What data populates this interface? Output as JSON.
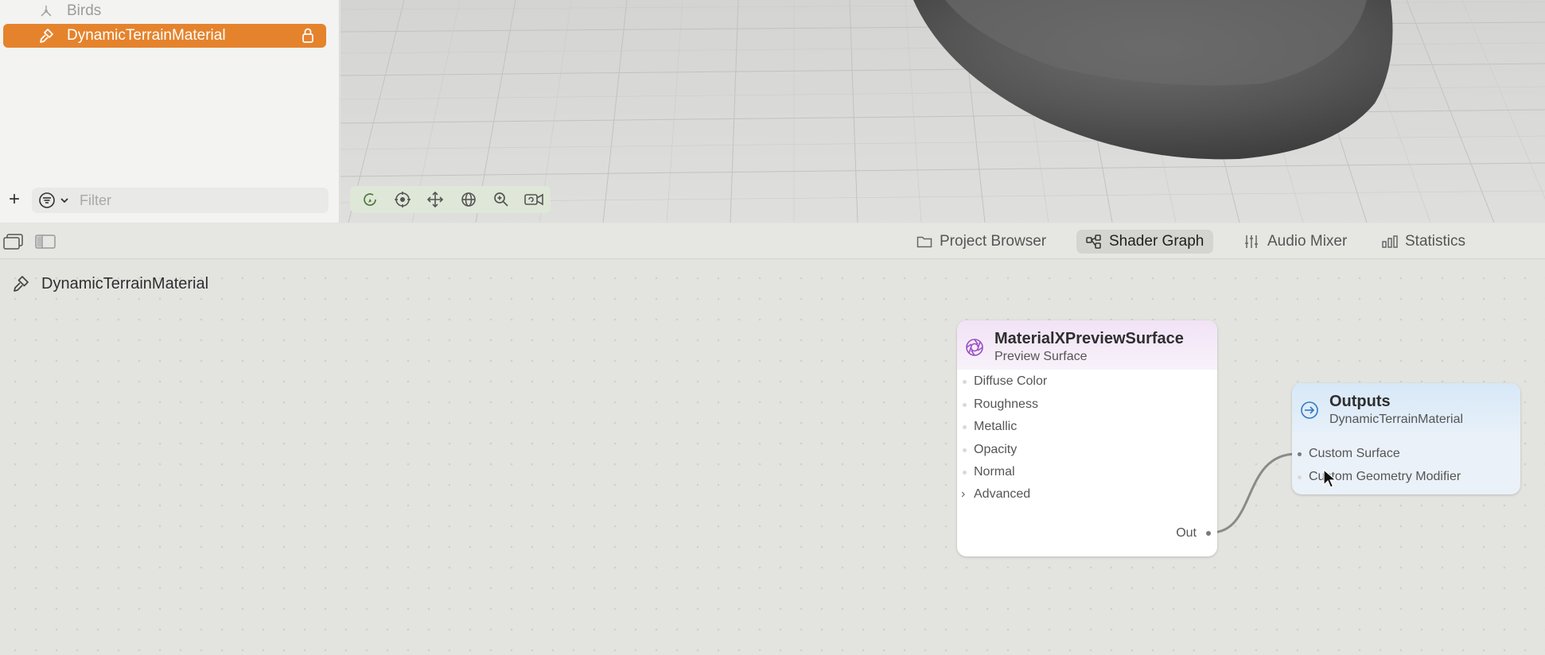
{
  "sidebar": {
    "items": [
      {
        "label": "Birds",
        "icon": "entity-icon"
      },
      {
        "label": "DynamicTerrainMaterial",
        "icon": "material-brush-icon",
        "selected": true,
        "locked": true
      }
    ],
    "filter_placeholder": "Filter",
    "accent_color": "#e5832d"
  },
  "viewport": {
    "tools": [
      "orbit-icon",
      "focus-icon",
      "move-icon",
      "globe-icon",
      "zoom-icon",
      "camera-icon"
    ]
  },
  "panel_tabs": [
    {
      "label": "Project Browser",
      "icon": "folder-icon"
    },
    {
      "label": "Shader Graph",
      "icon": "graph-icon",
      "active": true
    },
    {
      "label": "Audio Mixer",
      "icon": "sliders-icon"
    },
    {
      "label": "Statistics",
      "icon": "bar-chart-icon"
    }
  ],
  "graph": {
    "breadcrumb": "DynamicTerrainMaterial",
    "preview_node": {
      "title": "MaterialXPreviewSurface",
      "subtitle": "Preview Surface",
      "inputs": [
        "Diffuse Color",
        "Roughness",
        "Metallic",
        "Opacity",
        "Normal"
      ],
      "advanced_label": "Advanced",
      "output_label": "Out"
    },
    "outputs_node": {
      "title": "Outputs",
      "subtitle": "DynamicTerrainMaterial",
      "inputs": [
        "Custom Surface",
        "Custom Geometry Modifier"
      ]
    }
  }
}
